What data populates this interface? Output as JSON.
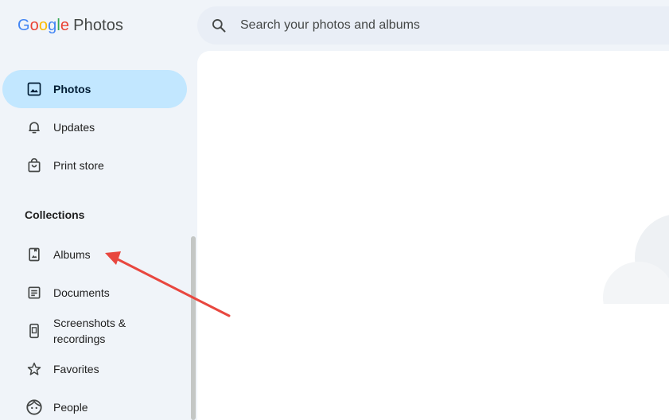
{
  "app": {
    "logo_word": [
      "G",
      "o",
      "o",
      "g",
      "l",
      "e"
    ],
    "product": "Photos"
  },
  "search": {
    "placeholder": "Search your photos and albums",
    "icon": "search-icon"
  },
  "sidebar": {
    "items": [
      {
        "label": "Photos",
        "icon": "photo-icon",
        "active": true
      },
      {
        "label": "Updates",
        "icon": "bell-icon"
      },
      {
        "label": "Print store",
        "icon": "shopping-bag-icon"
      }
    ],
    "section_title": "Collections",
    "collections": [
      {
        "label": "Albums",
        "icon": "album-icon"
      },
      {
        "label": "Documents",
        "icon": "document-icon"
      },
      {
        "label": "Screenshots &",
        "label2": "recordings",
        "icon": "phone-screenshot-icon"
      },
      {
        "label": "Favorites",
        "icon": "star-icon"
      },
      {
        "label": "People",
        "icon": "face-icon"
      }
    ]
  },
  "colors": {
    "active_bg": "#c2e7ff",
    "page_bg": "#f0f4f9",
    "annotation_arrow": "#e8473f"
  }
}
